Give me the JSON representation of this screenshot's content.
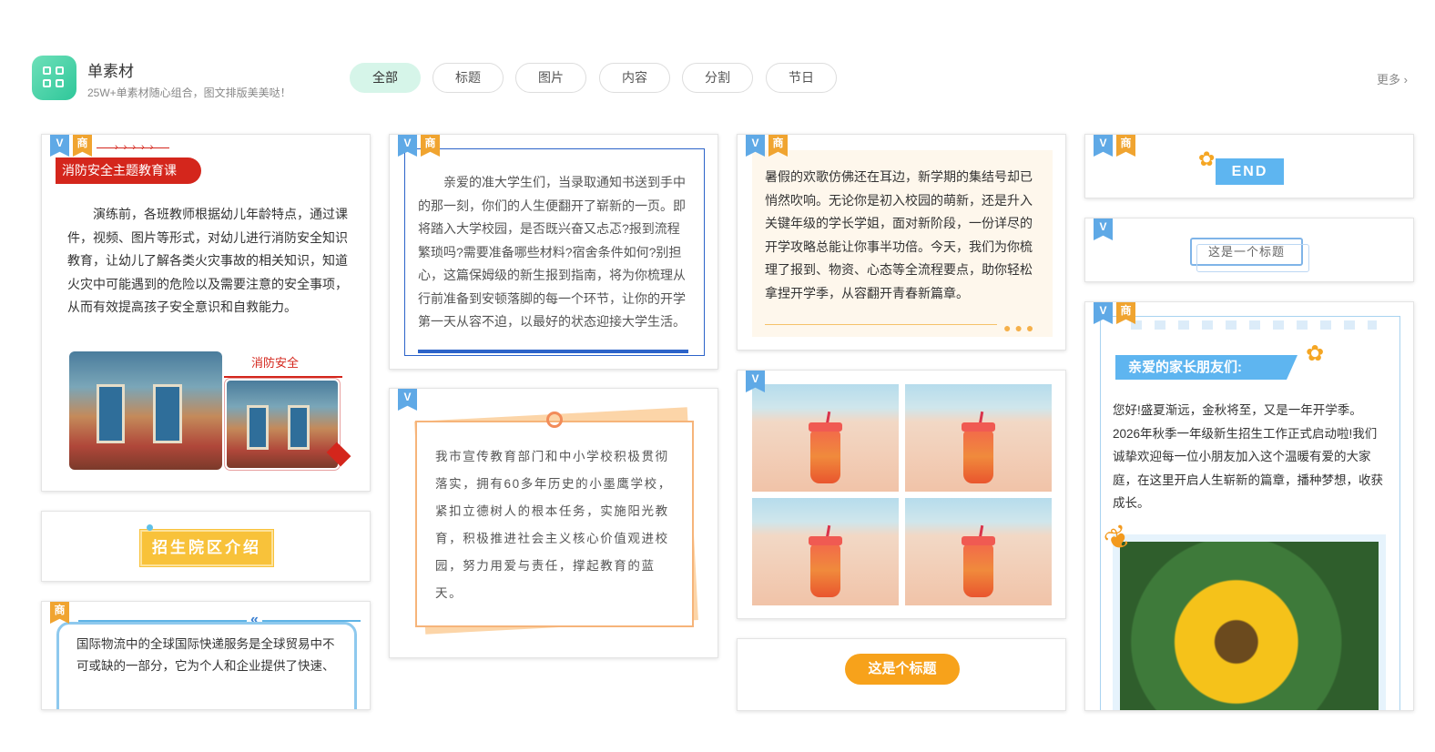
{
  "header": {
    "app_title": "单素材",
    "app_subtitle": "25W+单素材随心组合，图文排版美美哒！",
    "tabs": [
      {
        "label": "全部",
        "active": true
      },
      {
        "label": "标题",
        "active": false
      },
      {
        "label": "图片",
        "active": false
      },
      {
        "label": "内容",
        "active": false
      },
      {
        "label": "分割",
        "active": false
      },
      {
        "label": "节日",
        "active": false
      }
    ],
    "more_label": "更多 ›"
  },
  "badges": {
    "v": "V",
    "shang": "商"
  },
  "colors": {
    "accent_green": "#2fc79a",
    "tab_active_bg": "#d6f5e9",
    "badge_blue": "#5fa9e6",
    "badge_orange": "#f0a430",
    "fire_red": "#d4261c",
    "orange": "#f7a21b"
  },
  "cards": {
    "fire_safety": {
      "heading": "消防安全主题教育课",
      "body": "演练前，各班教师根据幼儿年龄特点，通过课件，视频、图片等形式，对幼儿进行消防安全知识教育，让幼儿了解各类火灾事故的相关知识，知道火灾中可能遇到的危险以及需要注意的安全事项，从而有效提高孩子安全意识和自救能力。",
      "image_caption": "消防安全"
    },
    "freshman": {
      "body": "亲爱的准大学生们，当录取通知书送到手中的那一刻，你们的人生便翻开了崭新的一页。即将踏入大学校园，是否既兴奋又忐忑?报到流程繁琐吗?需要准备哪些材料?宿舍条件如何?别担心，这篇保姆级的新生报到指南，将为你梳理从行前准备到安顿落脚的每一个环节，让你的开学第一天从容不迫，以最好的状态迎接大学生活。"
    },
    "summer": {
      "body": "暑假的欢歌仿佛还在耳边，新学期的集结号却已悄然吹响。无论你是初入校园的萌新，还是升入关键年级的学长学姐，面对新阶段，一份详尽的开学攻略总能让你事半功倍。今天，我们为你梳理了报到、物资、心态等全流程要点，助你轻松拿捏开学季，从容翻开青春新篇章。"
    },
    "end_title": {
      "text": "END"
    },
    "plain_title": {
      "text": "这是一个标题"
    },
    "parents": {
      "heading": "亲爱的家长朋友们:",
      "body": "您好!盛夏渐远，金秋将至，又是一年开学季。2026年秋季一年级新生招生工作正式启动啦!我们诚挚欢迎每一位小朋友加入这个温暖有爱的大家庭，在这里开启人生崭新的篇章，播种梦想，收获成长。"
    },
    "campus_intro": {
      "text": "招生院区介绍"
    },
    "education": {
      "body": "我市宣传教育部门和中小学校积极贯彻落实，拥有60多年历史的小墨鹰学校，紧扣立德树人的根本任务，实施阳光教育，积极推进社会主义核心价值观进校园，努力用爱与责任，撑起教育的蓝天。"
    },
    "logistics": {
      "body": "国际物流中的全球国际快递服务是全球贸易中不可或缺的一部分，它为个人和企业提供了快速、"
    },
    "orange_title": {
      "text": "这是个标题"
    }
  }
}
